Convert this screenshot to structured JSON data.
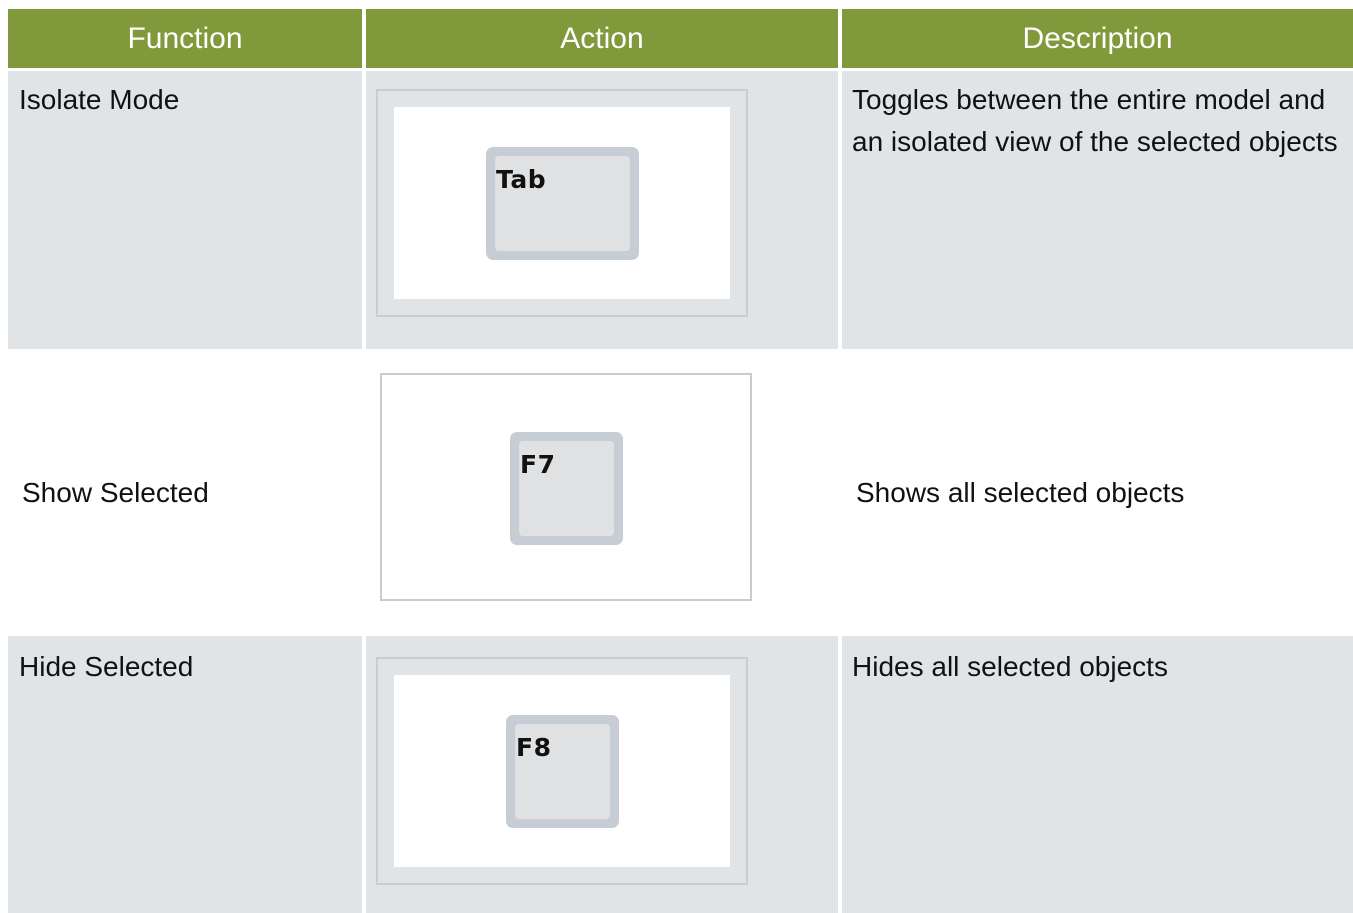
{
  "table": {
    "headers": {
      "function": "Function",
      "action": "Action",
      "description": "Description"
    },
    "rows": [
      {
        "function": "Isolate Mode",
        "key": "Tab",
        "description": "Toggles between the entire model and an isolated view of the selected objects"
      },
      {
        "function": "Show Selected",
        "key": "F7",
        "description": "Shows all selected objects"
      },
      {
        "function": "Hide Selected",
        "key": "F8",
        "description": "Hides all selected objects"
      }
    ]
  },
  "colors": {
    "header_bg": "#80993b",
    "row_shade": "#e1e4e7",
    "key_outer": "#c6cdd5",
    "key_inner": "#e0e1e3"
  }
}
